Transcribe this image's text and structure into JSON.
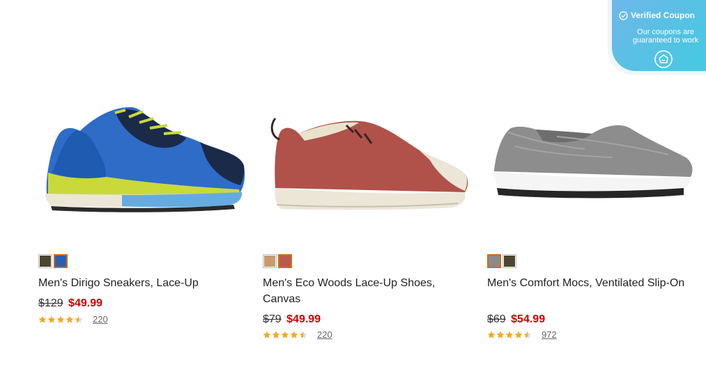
{
  "coupon": {
    "title": "Verified Coupon",
    "subtitle": "Our coupons are guaranteed to work",
    "check_icon": "check-circle-icon",
    "logo_icon": "tag-logo-icon"
  },
  "products": [
    {
      "name": "Men's Dirigo Sneakers, Lace-Up",
      "original_price": "$129",
      "sale_price": "$49.99",
      "rating": 4.5,
      "review_count": "220",
      "swatches": [
        {
          "color": "#4a4632",
          "selected": false
        },
        {
          "color": "#2b5fb0",
          "selected": true
        }
      ]
    },
    {
      "name": "Men's Eco Woods Lace-Up Shoes, Canvas",
      "original_price": "$79",
      "sale_price": "$49.99",
      "rating": 4.5,
      "review_count": "220",
      "swatches": [
        {
          "color": "#c79b6e",
          "selected": false
        },
        {
          "color": "#b95a4e",
          "selected": true
        }
      ]
    },
    {
      "name": "Men's Comfort Mocs, Ventilated Slip-On",
      "original_price": "$69",
      "sale_price": "$54.99",
      "rating": 4.5,
      "review_count": "972",
      "swatches": [
        {
          "color": "#8a8a8a",
          "selected": true
        },
        {
          "color": "#4d4530",
          "selected": false
        }
      ]
    }
  ],
  "colors": {
    "sale_price": "#cc0000",
    "star": "#f5a623",
    "swatch_selected_border": "#d46b12"
  }
}
